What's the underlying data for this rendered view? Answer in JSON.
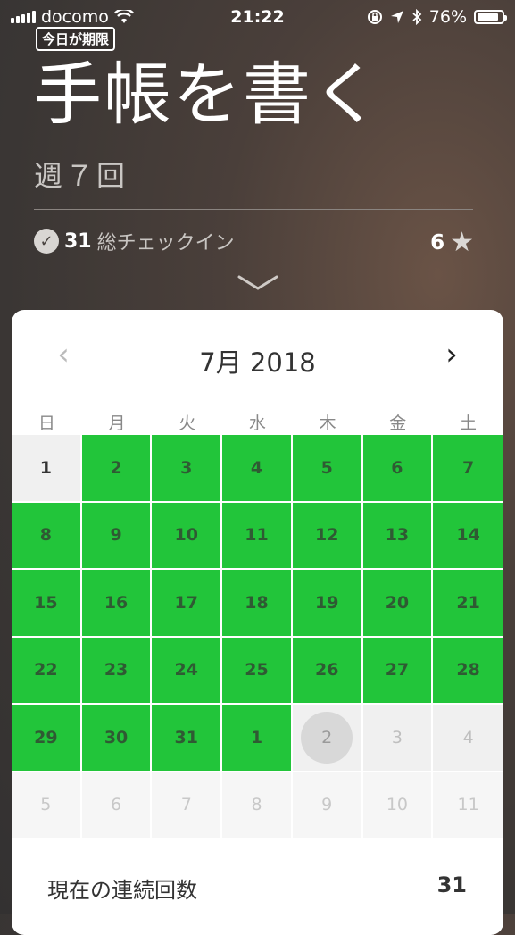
{
  "status_bar": {
    "carrier": "docomo",
    "time": "21:22",
    "battery": "76%",
    "battery_level": 0.76,
    "icons": [
      "signal-icon",
      "wifi-icon",
      "orientation-lock-icon",
      "location-icon",
      "bluetooth-icon",
      "battery-icon"
    ]
  },
  "habit": {
    "deadline_badge": "今日が期限",
    "title": "手帳を書く",
    "frequency": "週７回",
    "checkin_count": "31",
    "checkin_label": "総チェックイン",
    "stars": "6"
  },
  "calendar": {
    "month_label": "7月 2018",
    "weekdays": [
      "日",
      "月",
      "火",
      "水",
      "木",
      "金",
      "土"
    ],
    "rows": [
      [
        {
          "d": "1",
          "s": "today"
        },
        {
          "d": "2",
          "s": "done"
        },
        {
          "d": "3",
          "s": "done"
        },
        {
          "d": "4",
          "s": "done"
        },
        {
          "d": "5",
          "s": "done"
        },
        {
          "d": "6",
          "s": "done"
        },
        {
          "d": "7",
          "s": "done"
        }
      ],
      [
        {
          "d": "8",
          "s": "done"
        },
        {
          "d": "9",
          "s": "done"
        },
        {
          "d": "10",
          "s": "done"
        },
        {
          "d": "11",
          "s": "done"
        },
        {
          "d": "12",
          "s": "done"
        },
        {
          "d": "13",
          "s": "done"
        },
        {
          "d": "14",
          "s": "done"
        }
      ],
      [
        {
          "d": "15",
          "s": "done"
        },
        {
          "d": "16",
          "s": "done"
        },
        {
          "d": "17",
          "s": "done"
        },
        {
          "d": "18",
          "s": "done"
        },
        {
          "d": "19",
          "s": "done"
        },
        {
          "d": "20",
          "s": "done"
        },
        {
          "d": "21",
          "s": "done"
        }
      ],
      [
        {
          "d": "22",
          "s": "done"
        },
        {
          "d": "23",
          "s": "done"
        },
        {
          "d": "24",
          "s": "done"
        },
        {
          "d": "25",
          "s": "done"
        },
        {
          "d": "26",
          "s": "done"
        },
        {
          "d": "27",
          "s": "done"
        },
        {
          "d": "28",
          "s": "done"
        }
      ],
      [
        {
          "d": "29",
          "s": "done"
        },
        {
          "d": "30",
          "s": "done"
        },
        {
          "d": "31",
          "s": "done"
        },
        {
          "d": "1",
          "s": "done"
        },
        {
          "d": "2",
          "s": "current"
        },
        {
          "d": "3",
          "s": "future"
        },
        {
          "d": "4",
          "s": "future"
        }
      ],
      [
        {
          "d": "5",
          "s": "next"
        },
        {
          "d": "6",
          "s": "next"
        },
        {
          "d": "7",
          "s": "next"
        },
        {
          "d": "8",
          "s": "next"
        },
        {
          "d": "9",
          "s": "next"
        },
        {
          "d": "10",
          "s": "next"
        },
        {
          "d": "11",
          "s": "next"
        }
      ]
    ]
  },
  "streak": {
    "label": "現在の連続回数",
    "value": "31"
  },
  "colors": {
    "done": "#22c53a",
    "done_text": "#2f5a33",
    "empty": "#f0f0f0"
  }
}
